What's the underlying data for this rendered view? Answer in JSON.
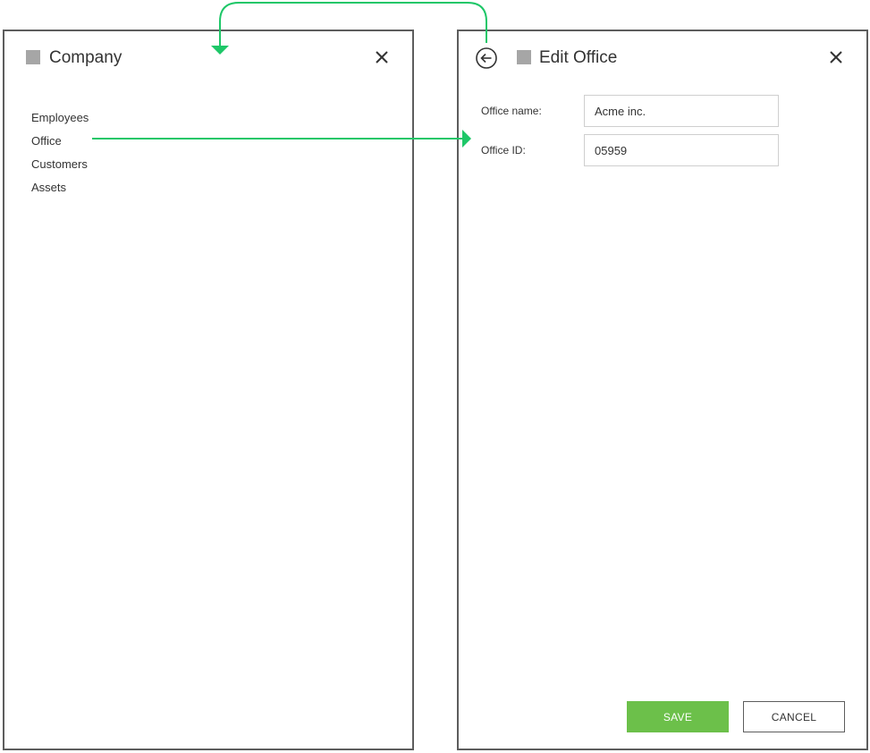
{
  "company_panel": {
    "title": "Company",
    "close_icon": "close-icon",
    "nav_items": [
      "Employees",
      "Office",
      "Customers",
      "Assets"
    ]
  },
  "edit_panel": {
    "title": "Edit Office",
    "back_icon": "back-arrow-icon",
    "close_icon": "close-icon",
    "fields": {
      "office_name": {
        "label": "Office name:",
        "value": "Acme inc."
      },
      "office_id": {
        "label": "Office ID:",
        "value": "05959"
      }
    },
    "save_label": "SAVE",
    "cancel_label": "CANCEL"
  },
  "colors": {
    "accent_green": "#6cc04a",
    "connector_green": "#1ec768",
    "panel_border": "#5d5d5d",
    "title_square": "#a6a6a6"
  }
}
